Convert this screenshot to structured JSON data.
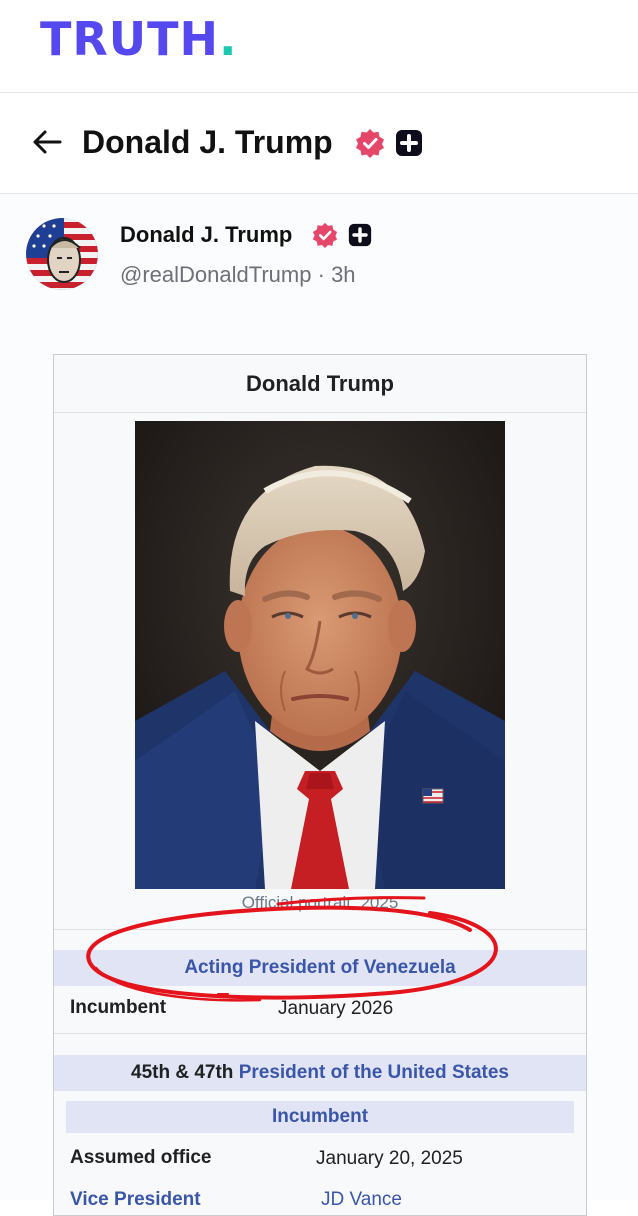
{
  "app": {
    "logo_text": "TRUTH",
    "logo_dot": ".",
    "brand_color": "#5448ee",
    "accent_color": "#1ec8b0"
  },
  "header": {
    "back_icon": "arrow-left-icon",
    "title": "Donald J. Trump",
    "badge_icons": [
      "verified-badge-icon",
      "plus-badge-icon"
    ]
  },
  "post": {
    "author": {
      "name": "Donald J. Trump",
      "handle": "@realDonaldTrump",
      "separator": "·",
      "time": "3h",
      "badge_icons": [
        "verified-badge-icon",
        "plus-badge-icon"
      ]
    },
    "infobox": {
      "title": "Donald Trump",
      "caption_left": "Official",
      "caption_struck": "portrait",
      "caption_right": ", 2025",
      "acting_office": "Acting President of Venezuela",
      "row1_label": "Incumbent",
      "row1_value": "January 2026",
      "office_prefix": "45th & 47th",
      "office_link": "President of the United States",
      "incumbent_label": "Incumbent",
      "assumed_label": "Assumed office",
      "assumed_value": "January 20, 2025",
      "vp_label": "Vice President",
      "vp_value": "JD Vance"
    },
    "annotation_color": "#e3141b"
  }
}
